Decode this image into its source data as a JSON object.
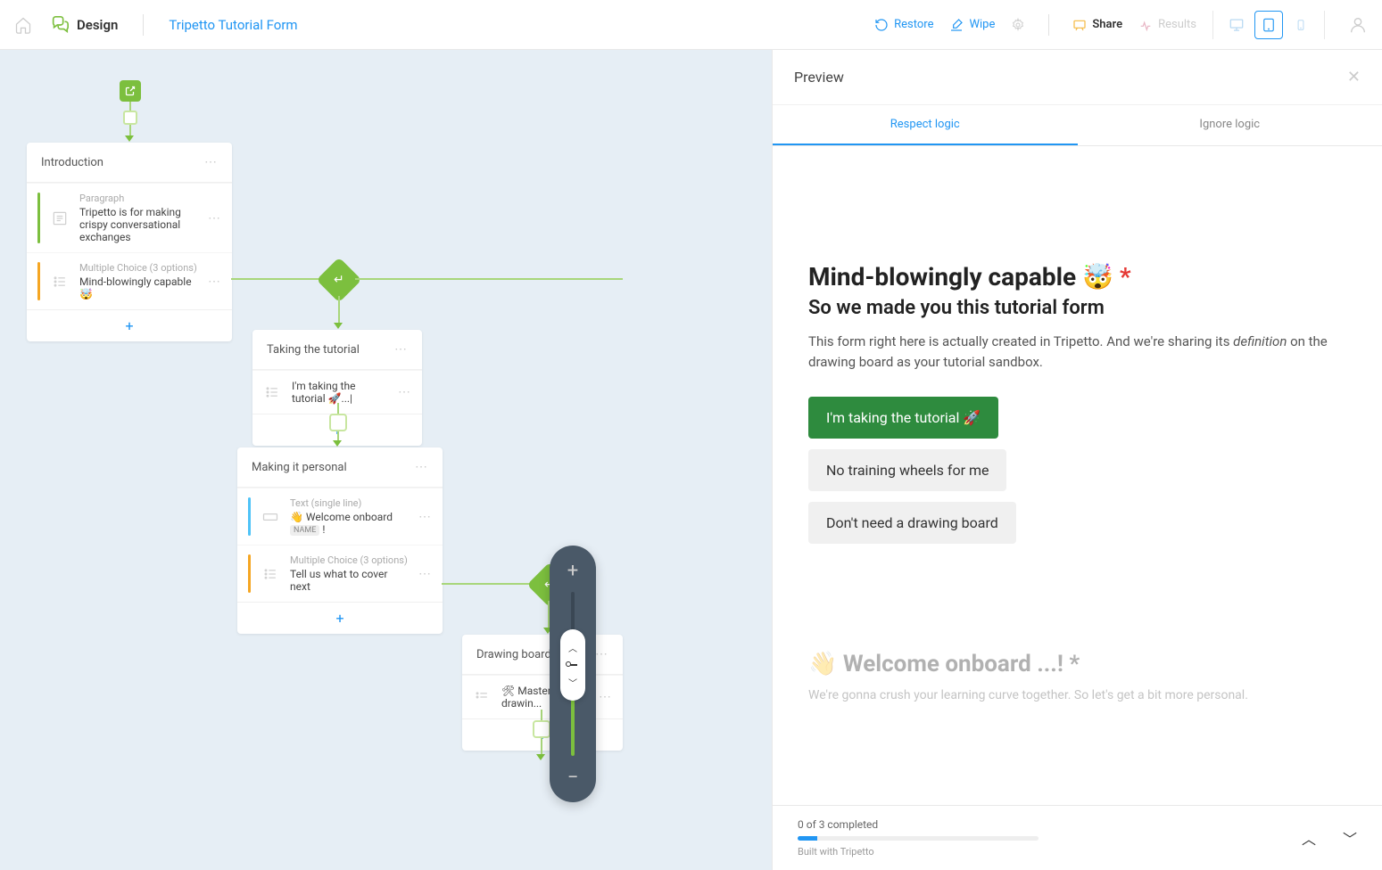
{
  "toolbar": {
    "design_label": "Design",
    "form_name": "Tripetto Tutorial Form",
    "restore": "Restore",
    "wipe": "Wipe",
    "share": "Share",
    "results": "Results"
  },
  "canvas": {
    "nodes": {
      "intro": {
        "title": "Introduction",
        "rows": [
          {
            "type": "Paragraph",
            "title": "Tripetto is for making crispy conversational exchanges"
          },
          {
            "type": "Multiple Choice (3 options)",
            "title": "Mind-blowingly capable 🤯"
          }
        ]
      },
      "tutorial": {
        "title": "Taking the tutorial",
        "rows": [
          {
            "title": "I'm taking the tutorial 🚀...|"
          }
        ]
      },
      "personal": {
        "title": "Making it personal",
        "rows": [
          {
            "type": "Text (single line)",
            "title_prefix": "👋 Welcome onboard ",
            "pill": "NAME",
            "title_suffix": " !"
          },
          {
            "type": "Multiple Choice (3 options)",
            "title": "Tell us what to cover next"
          }
        ]
      },
      "drawing": {
        "title": "Drawing board",
        "rows": [
          {
            "title": "🛠 Mastering the drawin..."
          }
        ]
      }
    }
  },
  "preview": {
    "header": "Preview",
    "tabs": {
      "respect": "Respect logic",
      "ignore": "Ignore logic"
    },
    "question": {
      "title": "Mind-blowingly capable 🤯",
      "subtitle": "So we made you this tutorial form",
      "desc_1": "This form right here is actually created in Tripetto. And we're sharing its ",
      "desc_em": "definition",
      "desc_2": " on the drawing board as your tutorial sandbox.",
      "choices": [
        "I'm taking the tutorial 🚀",
        "No training wheels for me",
        "Don't need a drawing board"
      ]
    },
    "faded": {
      "title": "👋 Welcome onboard ...! ",
      "desc": "We're gonna crush your learning curve together. So let's get a bit more personal."
    },
    "footer": {
      "progress": "0 of 3 completed",
      "credit": "Built with Tripetto"
    }
  }
}
